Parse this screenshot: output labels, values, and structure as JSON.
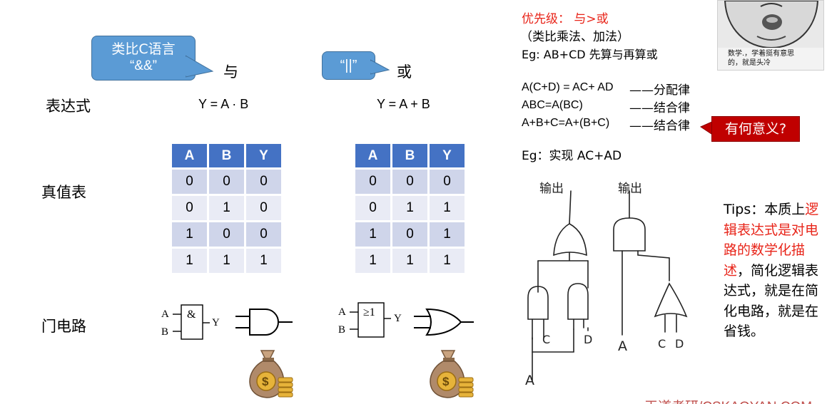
{
  "callouts": {
    "and_text_line1": "类比C语言",
    "and_text_line2": "“&&”",
    "or_text": "“||”"
  },
  "columns": {
    "and_title": "与",
    "or_title": "或"
  },
  "rows": {
    "expression_label": "表达式",
    "truth_table_label": "真值表",
    "gate_label": "门电路"
  },
  "expressions": {
    "and": "Y = A · B",
    "or": "Y = A + B"
  },
  "truth_tables": {
    "headers": [
      "A",
      "B",
      "Y"
    ],
    "and_rows": [
      [
        "0",
        "0",
        "0"
      ],
      [
        "0",
        "1",
        "0"
      ],
      [
        "1",
        "0",
        "0"
      ],
      [
        "1",
        "1",
        "1"
      ]
    ],
    "or_rows": [
      [
        "0",
        "0",
        "0"
      ],
      [
        "0",
        "1",
        "1"
      ],
      [
        "1",
        "0",
        "1"
      ],
      [
        "1",
        "1",
        "1"
      ]
    ]
  },
  "gates": {
    "and_symbol": "&",
    "or_symbol": "≥1",
    "in_a": "A",
    "in_b": "B",
    "out_y": "Y"
  },
  "money_bag_symbol": "$",
  "right_panel": {
    "priority_line": "优先级：  与>或",
    "priority_note": "（类比乘法、加法）",
    "eg_line": "Eg: AB+CD   先算与再算或",
    "law_1": "A(C+D) = AC+ AD",
    "law_1_name": "——分配律",
    "law_2": "ABC=A(BC)",
    "law_2_name": "——结合律",
    "law_3": "A+B+C=A+(B+C)",
    "law_3_name": "——结合律",
    "meaning_label": "有何意义?",
    "eg2_line": "Eg：实现 AC+AD",
    "output_label": "输出",
    "sketch_labels": {
      "c": "C",
      "d": "D",
      "a_left": "A",
      "a_right": "A",
      "c2": "C",
      "d2": "D"
    },
    "meme_caption_line1": "数学.，学着挺有意思",
    "meme_caption_line2": "的，就是头冷",
    "tips_prefix": "Tips：本质上",
    "tips_red": "逻辑表达式是对电路的数学化描述",
    "tips_suffix": "，简化逻辑表达式，就是在简化电路，就是在省钱。"
  },
  "footer": "王道考研/CSKAOYAN.COM",
  "colors": {
    "callout_blue": "#5b9bd5",
    "table_header": "#4472c4",
    "table_row_odd": "#cfd5ea",
    "table_row_even": "#e9ebf5",
    "priority_red": "#e8251a",
    "meaning_red": "#c00000",
    "footer_red": "#c0504d",
    "bag_brown": "#b08a6a",
    "coin_gold": "#e6b33a"
  }
}
